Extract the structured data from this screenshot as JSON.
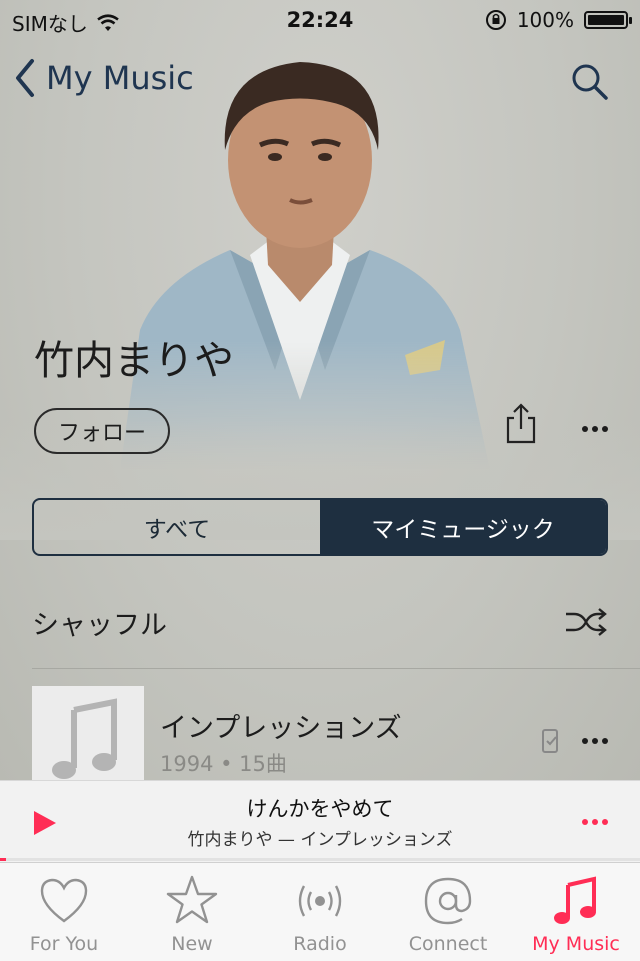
{
  "status_bar": {
    "carrier": "SIMなし",
    "time": "22:24",
    "battery": "100%",
    "icons": [
      "wifi-icon",
      "rotation-lock-icon",
      "battery-icon"
    ]
  },
  "nav": {
    "back_label": "My Music",
    "icons": [
      "chevron-left-icon",
      "search-icon"
    ]
  },
  "artist": {
    "name": "竹内まりや",
    "follow_label": "フォロー",
    "icons": [
      "share-icon",
      "more-icon"
    ]
  },
  "segment": {
    "options": [
      "すべて",
      "マイミュージック"
    ],
    "selected": "マイミュージック"
  },
  "shuffle": {
    "label": "シャッフル",
    "icon": "shuffle-icon"
  },
  "albums": [
    {
      "title": "インプレッションズ",
      "meta": "1994 • 15曲",
      "icons": [
        "music-note-icon",
        "device-icon",
        "more-icon"
      ]
    }
  ],
  "now_playing": {
    "title": "けんかをやめて",
    "subtitle": "竹内まりや — インプレッションズ",
    "progress": 0.01,
    "icons": [
      "play-icon",
      "more-icon"
    ]
  },
  "tabs": [
    {
      "label": "For You",
      "icon": "heart-icon",
      "active": false
    },
    {
      "label": "New",
      "icon": "star-icon",
      "active": false
    },
    {
      "label": "Radio",
      "icon": "radio-icon",
      "active": false
    },
    {
      "label": "Connect",
      "icon": "at-icon",
      "active": false
    },
    {
      "label": "My Music",
      "icon": "music-note-icon",
      "active": true
    }
  ],
  "colors": {
    "accent": "#ff2d55",
    "nav_tint": "#1f3550",
    "segment_dark": "#1e2f40"
  }
}
